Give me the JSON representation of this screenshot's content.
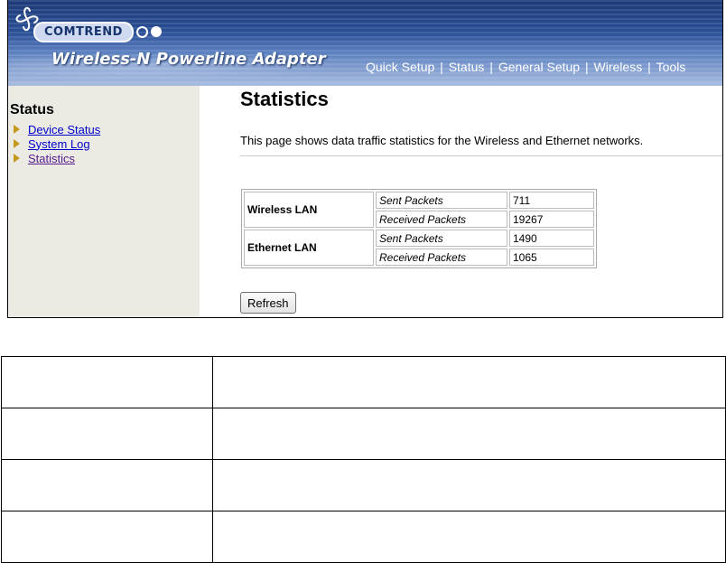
{
  "header": {
    "brand": "COMTREND",
    "product": "Wireless-N Powerline Adapter",
    "nav": [
      "Quick Setup",
      "Status",
      "General Setup",
      "Wireless",
      "Tools"
    ],
    "colors": {
      "banner_dark": "#1d3a78",
      "banner_light": "#a8bce0"
    }
  },
  "sidebar": {
    "title": "Status",
    "items": [
      {
        "label": "Device Status",
        "icon": "triangle-bullet-icon"
      },
      {
        "label": "System Log",
        "icon": "triangle-bullet-icon"
      },
      {
        "label": "Statistics",
        "icon": "triangle-bullet-icon"
      }
    ]
  },
  "main": {
    "title": "Statistics",
    "description": "This page shows data traffic statistics for the Wireless and Ethernet networks.",
    "stats": [
      {
        "network": "Wireless LAN",
        "rows": [
          {
            "label": "Sent Packets",
            "value": "711"
          },
          {
            "label": "Received Packets",
            "value": "19267"
          }
        ]
      },
      {
        "network": "Ethernet LAN",
        "rows": [
          {
            "label": "Sent Packets",
            "value": "1490"
          },
          {
            "label": "Received Packets",
            "value": "1065"
          }
        ]
      }
    ],
    "refresh_label": "Refresh"
  }
}
